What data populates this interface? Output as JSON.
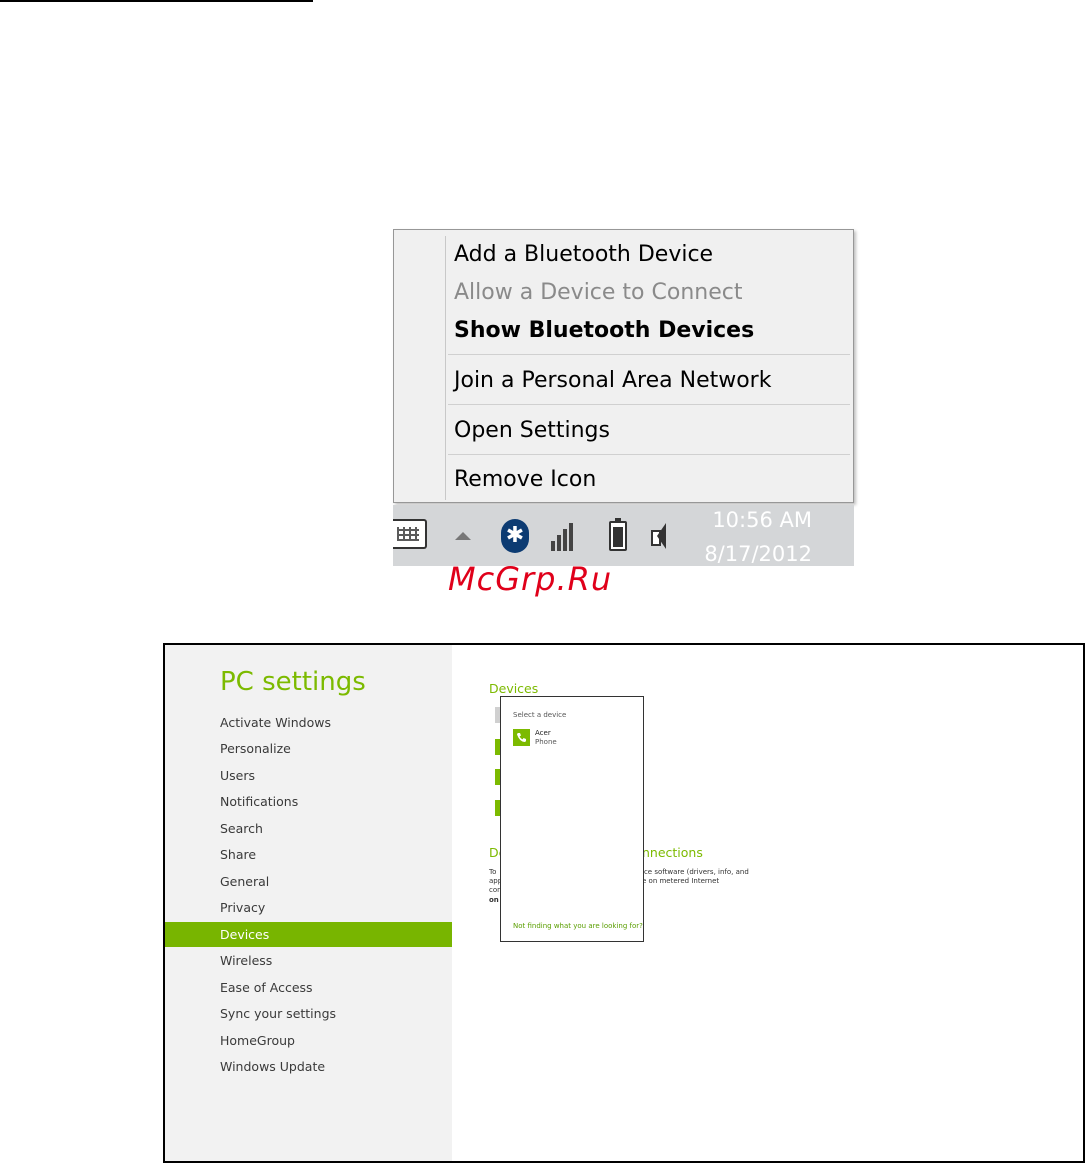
{
  "context_menu": {
    "items": [
      {
        "label": "Add a Bluetooth Device",
        "state": "normal"
      },
      {
        "label": "Allow a Device to Connect",
        "state": "disabled"
      },
      {
        "label": "Show Bluetooth Devices",
        "state": "default"
      },
      {
        "label": "Join a Personal Area Network",
        "state": "normal"
      },
      {
        "label": "Open Settings",
        "state": "normal"
      },
      {
        "label": "Remove Icon",
        "state": "normal"
      }
    ]
  },
  "taskbar": {
    "time": "10:56 AM",
    "date": "8/17/2012",
    "bluetooth_glyph": "✱",
    "icons": [
      "keyboard-icon",
      "show-hidden-icons-arrow",
      "bluetooth-icon",
      "signal-icon",
      "battery-icon",
      "speaker-icon"
    ]
  },
  "watermark": "McGrp.Ru",
  "pc_settings": {
    "title": "PC settings",
    "accent_color": "#7cba00",
    "nav": [
      "Activate Windows",
      "Personalize",
      "Users",
      "Notifications",
      "Search",
      "Share",
      "General",
      "Privacy",
      "Devices",
      "Wireless",
      "Ease of Access",
      "Sync your settings",
      "HomeGroup",
      "Windows Update"
    ],
    "active_nav": "Devices",
    "main": {
      "devices_heading": "Devices",
      "connections_heading_start": "De",
      "connections_heading_end": "nnections",
      "connections_text_left": [
        "To",
        "app",
        "con",
        "on"
      ],
      "connections_text_right": [
        "ice software (drivers, info, and",
        "e on metered Internet"
      ]
    },
    "flyout": {
      "title": "Select a device",
      "device_name": "Acer",
      "device_type": "Phone",
      "link": "Not finding what you are looking for?"
    }
  }
}
